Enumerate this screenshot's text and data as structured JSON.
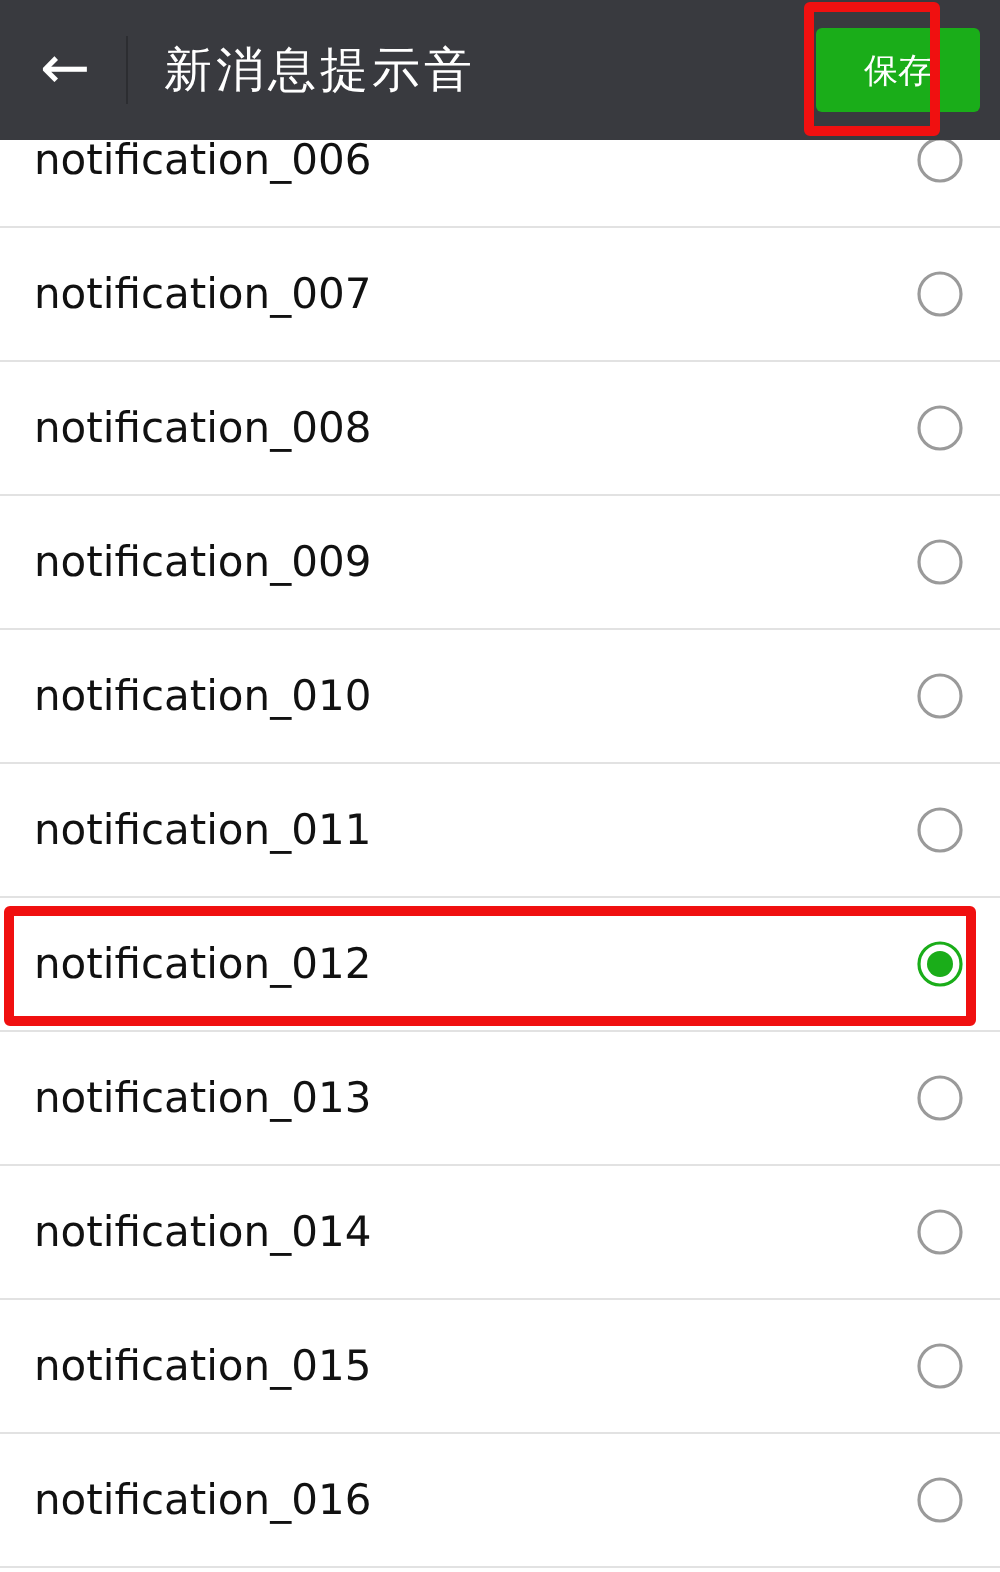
{
  "header": {
    "back_icon": "←",
    "title": "新消息提示音",
    "save_button": {
      "label": "保存",
      "highlighted": true
    }
  },
  "sounds": [
    {
      "name": "notification_006",
      "selected": false,
      "highlighted": false
    },
    {
      "name": "notification_007",
      "selected": false,
      "highlighted": false
    },
    {
      "name": "notification_008",
      "selected": false,
      "highlighted": false
    },
    {
      "name": "notification_009",
      "selected": false,
      "highlighted": false
    },
    {
      "name": "notification_010",
      "selected": false,
      "highlighted": false
    },
    {
      "name": "notification_011",
      "selected": false,
      "highlighted": false
    },
    {
      "name": "notification_012",
      "selected": true,
      "highlighted": true
    },
    {
      "name": "notification_013",
      "selected": false,
      "highlighted": false
    },
    {
      "name": "notification_014",
      "selected": false,
      "highlighted": false
    },
    {
      "name": "notification_015",
      "selected": false,
      "highlighted": false
    },
    {
      "name": "notification_016",
      "selected": false,
      "highlighted": false
    }
  ]
}
